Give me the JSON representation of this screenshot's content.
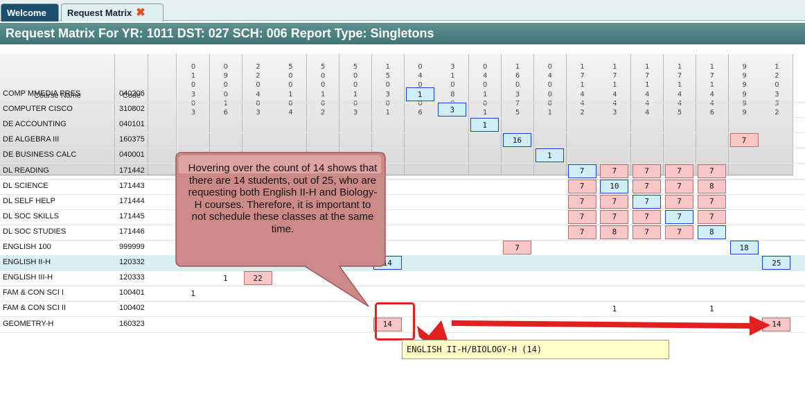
{
  "tabs": [
    {
      "label": "Welcome",
      "active": false
    },
    {
      "label": "Request Matrix",
      "active": true,
      "close_icon": "close-x-icon"
    }
  ],
  "title": "Request Matrix For YR: 1011 DST: 027 SCH: 006 Report Type: Singletons",
  "table": {
    "header_course": "Course Name",
    "header_code": "Code",
    "columns": [
      "010303",
      "090016",
      "220403",
      "500104",
      "500102",
      "500103",
      "150301",
      "040206",
      "310802",
      "040101",
      "160375",
      "040001",
      "171442",
      "171443",
      "171444",
      "171445",
      "171446",
      "999999",
      "120332"
    ],
    "rows": [
      {
        "name": "COMP MMEDIA PRES",
        "code": "040206"
      },
      {
        "name": "COMPUTER CISCO",
        "code": "310802"
      },
      {
        "name": "DE ACCOUNTING",
        "code": "040101"
      },
      {
        "name": "DE ALGEBRA III",
        "code": "160375"
      },
      {
        "name": "DE BUSINESS CALC",
        "code": "040001"
      },
      {
        "name": "DL READING",
        "code": "171442"
      },
      {
        "name": "DL SCIENCE",
        "code": "171443"
      },
      {
        "name": "DL SELF HELP",
        "code": "171444"
      },
      {
        "name": "DL SOC SKILLS",
        "code": "171445"
      },
      {
        "name": "DL SOC STUDIES",
        "code": "171446"
      },
      {
        "name": "ENGLISH 100",
        "code": "999999"
      },
      {
        "name": "ENGLISH II-H",
        "code": "120332"
      },
      {
        "name": "ENGLISH III-H",
        "code": "120333"
      },
      {
        "name": "FAM & CON SCI I",
        "code": "100401"
      },
      {
        "name": "FAM & CON SCI II",
        "code": "100402"
      },
      {
        "name": "GEOMETRY-H",
        "code": "160323"
      }
    ],
    "cells": [
      {
        "row": 0,
        "col": 7,
        "value": "1",
        "style": "blue"
      },
      {
        "row": 1,
        "col": 8,
        "value": "3",
        "style": "blue"
      },
      {
        "row": 2,
        "col": 9,
        "value": "1",
        "style": "blue"
      },
      {
        "row": 3,
        "col": 10,
        "value": "16",
        "style": "blue"
      },
      {
        "row": 3,
        "col": 17,
        "value": "7",
        "style": "pink"
      },
      {
        "row": 4,
        "col": 11,
        "value": "1",
        "style": "blue"
      },
      {
        "row": 5,
        "col": 12,
        "value": "7",
        "style": "blue"
      },
      {
        "row": 5,
        "col": 13,
        "value": "7",
        "style": "pink"
      },
      {
        "row": 5,
        "col": 14,
        "value": "7",
        "style": "pink"
      },
      {
        "row": 5,
        "col": 15,
        "value": "7",
        "style": "pink"
      },
      {
        "row": 5,
        "col": 16,
        "value": "7",
        "style": "pink"
      },
      {
        "row": 6,
        "col": 12,
        "value": "7",
        "style": "pink"
      },
      {
        "row": 6,
        "col": 13,
        "value": "10",
        "style": "blue"
      },
      {
        "row": 6,
        "col": 14,
        "value": "7",
        "style": "pink"
      },
      {
        "row": 6,
        "col": 15,
        "value": "7",
        "style": "pink"
      },
      {
        "row": 6,
        "col": 16,
        "value": "8",
        "style": "pink"
      },
      {
        "row": 7,
        "col": 12,
        "value": "7",
        "style": "pink"
      },
      {
        "row": 7,
        "col": 13,
        "value": "7",
        "style": "pink"
      },
      {
        "row": 7,
        "col": 14,
        "value": "7",
        "style": "blue"
      },
      {
        "row": 7,
        "col": 15,
        "value": "7",
        "style": "pink"
      },
      {
        "row": 7,
        "col": 16,
        "value": "7",
        "style": "pink"
      },
      {
        "row": 8,
        "col": 12,
        "value": "7",
        "style": "pink"
      },
      {
        "row": 8,
        "col": 13,
        "value": "7",
        "style": "pink"
      },
      {
        "row": 8,
        "col": 14,
        "value": "7",
        "style": "pink"
      },
      {
        "row": 8,
        "col": 15,
        "value": "7",
        "style": "blue"
      },
      {
        "row": 8,
        "col": 16,
        "value": "7",
        "style": "pink"
      },
      {
        "row": 9,
        "col": 12,
        "value": "7",
        "style": "pink"
      },
      {
        "row": 9,
        "col": 13,
        "value": "8",
        "style": "pink"
      },
      {
        "row": 9,
        "col": 14,
        "value": "7",
        "style": "pink"
      },
      {
        "row": 9,
        "col": 15,
        "value": "7",
        "style": "pink"
      },
      {
        "row": 9,
        "col": 16,
        "value": "8",
        "style": "blue"
      },
      {
        "row": 10,
        "col": 10,
        "value": "7",
        "style": "pink"
      },
      {
        "row": 10,
        "col": 17,
        "value": "18",
        "style": "blue"
      },
      {
        "row": 11,
        "col": 6,
        "value": "14",
        "style": "blue"
      },
      {
        "row": 11,
        "col": 18,
        "value": "25",
        "style": "blue"
      },
      {
        "row": 12,
        "col": 1,
        "value": "1",
        "style": "plain"
      },
      {
        "row": 12,
        "col": 2,
        "value": "22",
        "style": "pink"
      },
      {
        "row": 13,
        "col": 0,
        "value": "1",
        "style": "plain"
      },
      {
        "row": 14,
        "col": 13,
        "value": "1",
        "style": "plain"
      },
      {
        "row": 14,
        "col": 16,
        "value": "1",
        "style": "plain"
      },
      {
        "row": 15,
        "col": 6,
        "value": "14",
        "style": "pink"
      },
      {
        "row": 15,
        "col": 18,
        "value": "14",
        "style": "pink"
      }
    ]
  },
  "callout": "Hovering over the count of 14 shows that there are 14 students, out of 25, who are requesting both English II-H and Biology-H courses.  Therefore, it is important to not schedule these classes at the same time.",
  "tooltip": "ENGLISH II-H/BIOLOGY-H (14)",
  "colors": {
    "pink": "#f9c6c6",
    "blue_border": "#1a3ed8",
    "blue_fill": "#cfeef7",
    "arrow": "#e22020",
    "callout": "#cf8f8f"
  }
}
